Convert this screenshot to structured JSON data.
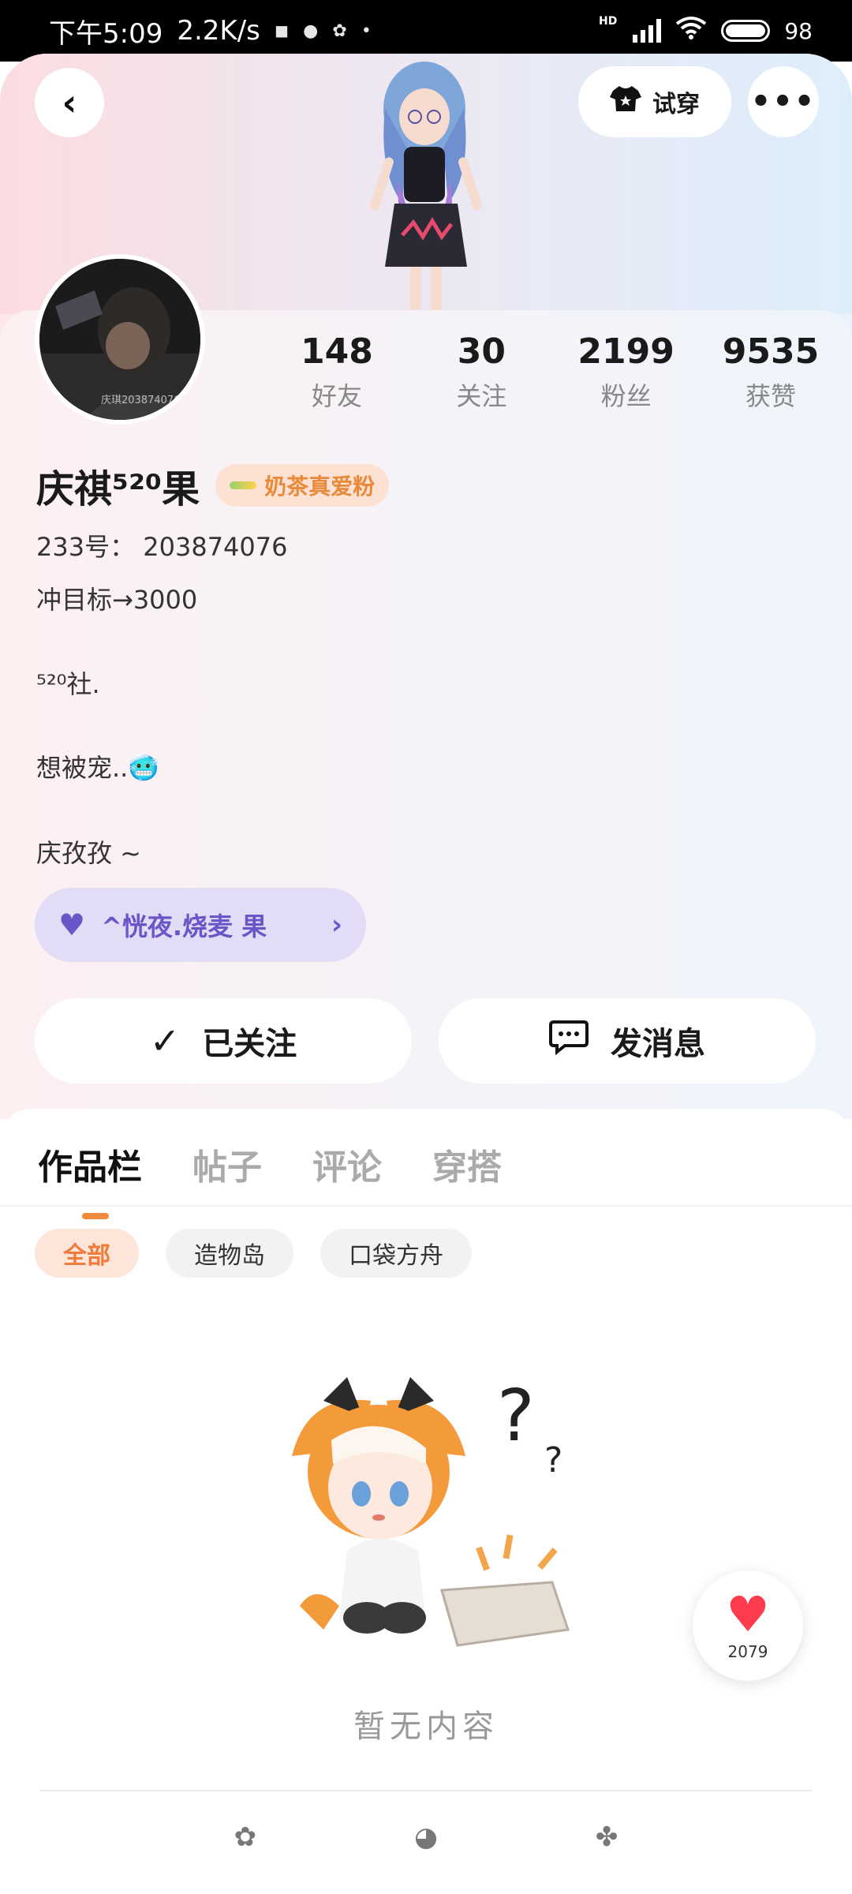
{
  "status_bar": {
    "time": "下午5:09",
    "speed": "2.2K/s",
    "dot": "•",
    "hd": "HD",
    "battery": "98"
  },
  "header": {
    "back_icon": "back-chevron-icon",
    "tryon_label": "试穿",
    "more_icon": "more-dots-icon"
  },
  "profile": {
    "avatar_watermark": "庆琪203874076",
    "stats": [
      {
        "value": "148",
        "label": "好友"
      },
      {
        "value": "30",
        "label": "关注"
      },
      {
        "value": "2199",
        "label": "粉丝"
      },
      {
        "value": "9535",
        "label": "获赞"
      }
    ],
    "name": "庆祺⁵²⁰果",
    "badge": "奶茶真爱粉",
    "id_line": "233号：  203874076",
    "goal_line": "冲目标→3000",
    "bio_line1": "⁵²⁰社.",
    "bio_line2": "想被宠..🥶",
    "bio_line3": "庆孜孜 ~",
    "group_label": "^恍夜.烧麦  果",
    "follow_label": "已关注",
    "message_label": "发消息"
  },
  "tabs": [
    {
      "label": "作品栏",
      "active": true
    },
    {
      "label": "帖子",
      "active": false
    },
    {
      "label": "评论",
      "active": false
    },
    {
      "label": "穿搭",
      "active": false
    }
  ],
  "chips": [
    {
      "label": "全部",
      "active": true
    },
    {
      "label": "造物岛",
      "active": false
    },
    {
      "label": "口袋方舟",
      "active": false
    }
  ],
  "empty_text": "暂无内容",
  "like_count": "2079",
  "colors": {
    "accent": "#f08a3c",
    "group_pill_bg": "#e3dcf6",
    "group_pill_text": "#6b56c9",
    "heart": "#ff3b4e"
  }
}
